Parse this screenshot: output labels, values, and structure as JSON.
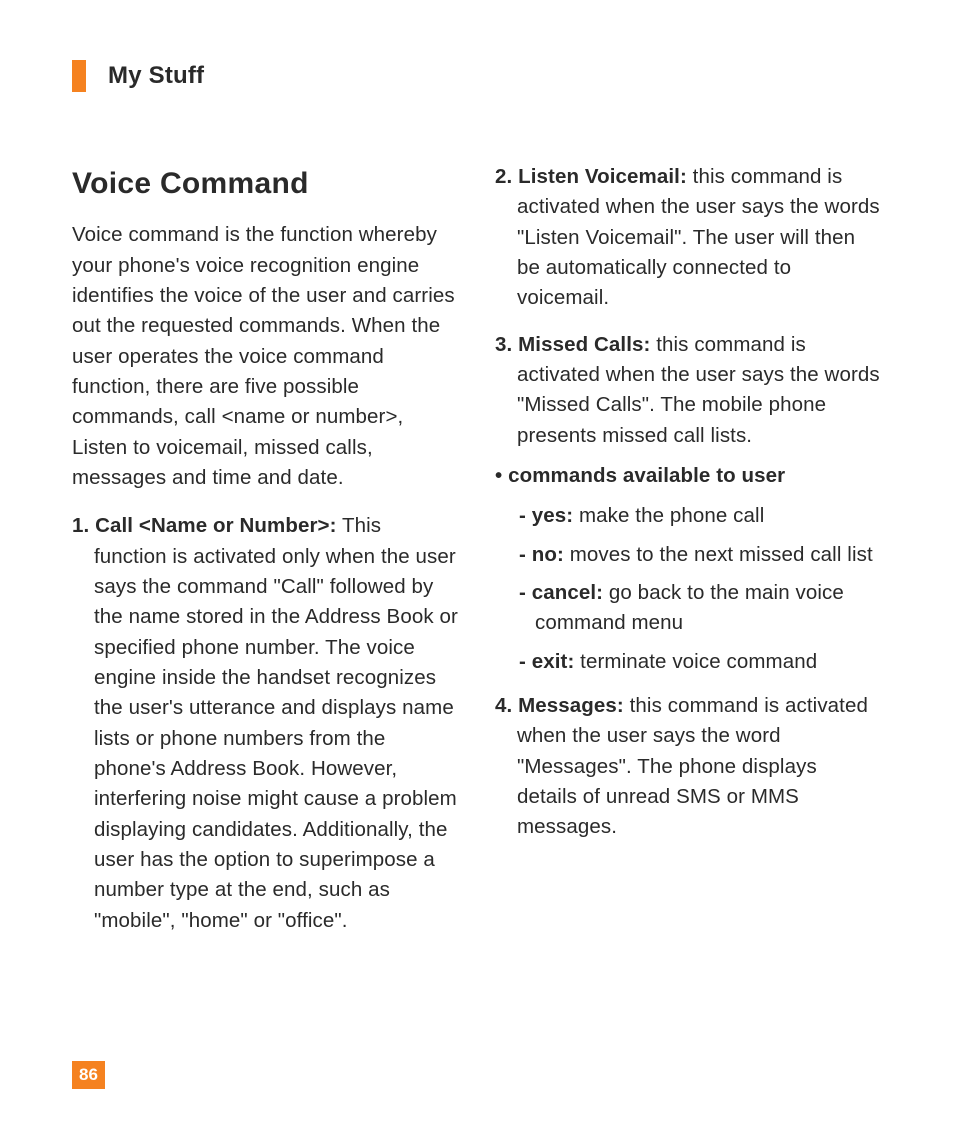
{
  "header": {
    "section": "My Stuff"
  },
  "title": "Voice Command",
  "intro": "Voice command is the function whereby your phone's voice recognition engine identifies the voice of the user and carries out the requested commands. When the user operates the voice command function, there are five possible commands, call <name or number>, Listen to voicemail, missed calls, messages and time and date.",
  "items": {
    "1": {
      "num": "1.",
      "label": "Call <Name or Number>:",
      "body": " This function is activated only when the user says the command \"Call\" followed by the name stored in the Address Book or specified phone number. The voice engine inside the handset recognizes the user's utterance and displays name lists or phone numbers from the phone's Address Book. However, interfering noise might cause a problem displaying candidates. Additionally, the user has the option to superimpose a number type at the end, such as \"mobile\", \"home\" or \"office\"."
    },
    "2": {
      "num": "2.",
      "label": "Listen Voicemail:",
      "body": " this command is activated when the user says the words \"Listen Voicemail\". The user will then be automatically connected to voicemail."
    },
    "3": {
      "num": "3.",
      "label": "Missed Calls:",
      "body": " this command is activated when the user says the words \"Missed Calls\". The mobile phone presents missed call lists."
    },
    "4": {
      "num": "4.",
      "label": "Messages:",
      "body": " this command is activated when the user says the word \"Messages\". The phone displays details of unread SMS or MMS messages."
    }
  },
  "sub": {
    "bullet": "•",
    "heading": "commands available to user",
    "dash": "-",
    "yes_label": "yes:",
    "yes_body": " make the phone call",
    "no_label": "no:",
    "no_body": " moves to the next missed call list",
    "cancel_label": "cancel:",
    "cancel_body": " go back to the main voice command menu",
    "exit_label": "exit:",
    "exit_body": " terminate voice command"
  },
  "page_number": "86"
}
